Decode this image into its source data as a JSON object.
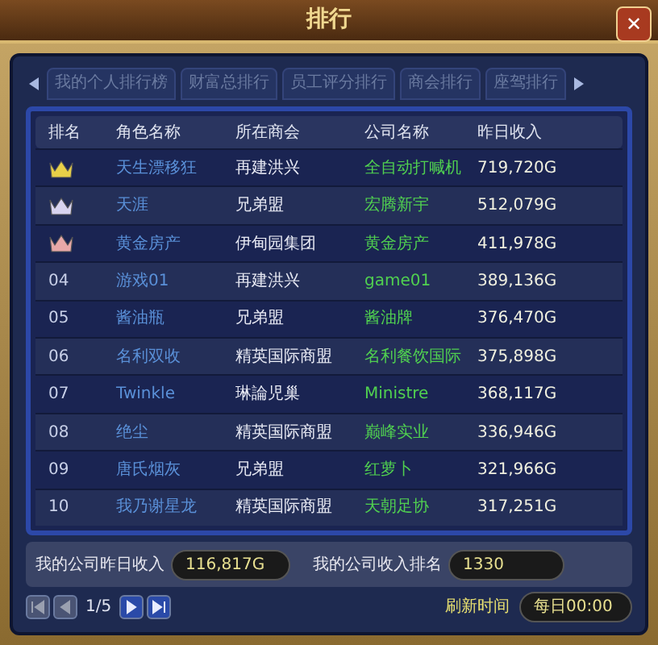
{
  "window": {
    "title": "排行",
    "close": "✕"
  },
  "tabs": [
    {
      "label": "我的个人排行榜",
      "selected": false
    },
    {
      "label": "财富总排行",
      "selected": false
    },
    {
      "label": "员工评分排行",
      "selected": false
    },
    {
      "label": "商会排行",
      "selected": false
    },
    {
      "label": "座驾排行",
      "selected": false
    }
  ],
  "table": {
    "columns": [
      "排名",
      "角色名称",
      "所在商会",
      "公司名称",
      "昨日收入"
    ],
    "rows": [
      {
        "rank": {
          "kind": "crown",
          "color": "#e8d048"
        },
        "name": "天生漂移狂",
        "guild": "再建洪兴",
        "company": "全自动打喊机",
        "income": "719,720G"
      },
      {
        "rank": {
          "kind": "crown",
          "color": "#d8d4f0"
        },
        "name": "天涯",
        "guild": "兄弟盟",
        "company": "宏腾新宇",
        "income": "512,079G"
      },
      {
        "rank": {
          "kind": "crown",
          "color": "#e8a8a8"
        },
        "name": "黄金房产",
        "guild": "伊甸园集团",
        "company": "黄金房产",
        "income": "411,978G"
      },
      {
        "rank": {
          "kind": "number",
          "text": "04"
        },
        "name": "游戏01",
        "guild": "再建洪兴",
        "company": "game01",
        "income": "389,136G"
      },
      {
        "rank": {
          "kind": "number",
          "text": "05"
        },
        "name": "酱油瓶",
        "guild": "兄弟盟",
        "company": "酱油牌",
        "income": "376,470G"
      },
      {
        "rank": {
          "kind": "number",
          "text": "06"
        },
        "name": "名利双收",
        "guild": "精英国际商盟",
        "company": "名利餐饮国际",
        "income": "375,898G"
      },
      {
        "rank": {
          "kind": "number",
          "text": "07"
        },
        "name": "Twinkle",
        "guild": "琳論児巢",
        "company": "Ministre",
        "income": "368,117G"
      },
      {
        "rank": {
          "kind": "number",
          "text": "08"
        },
        "name": "绝尘",
        "guild": "精英国际商盟",
        "company": "巅峰实业",
        "income": "336,946G"
      },
      {
        "rank": {
          "kind": "number",
          "text": "09"
        },
        "name": "唐氏烟灰",
        "guild": "兄弟盟",
        "company": "红萝卜",
        "income": "321,966G"
      },
      {
        "rank": {
          "kind": "number",
          "text": "10"
        },
        "name": "我乃谢星龙",
        "guild": "精英国际商盟",
        "company": "天朝足协",
        "income": "317,251G"
      }
    ]
  },
  "summary": [
    {
      "label": "我的公司昨日收入",
      "value": "116,817G"
    },
    {
      "label": "我的公司收入排名",
      "value": "1330"
    }
  ],
  "pager": {
    "buttons": [
      {
        "kind": "first",
        "disabled": true
      },
      {
        "kind": "prev",
        "disabled": true
      },
      {
        "kind": "next",
        "disabled": false
      },
      {
        "kind": "last",
        "disabled": false
      }
    ],
    "page": "1/5"
  },
  "refresh": {
    "label": "刷新时间",
    "value": "每日00:00"
  }
}
